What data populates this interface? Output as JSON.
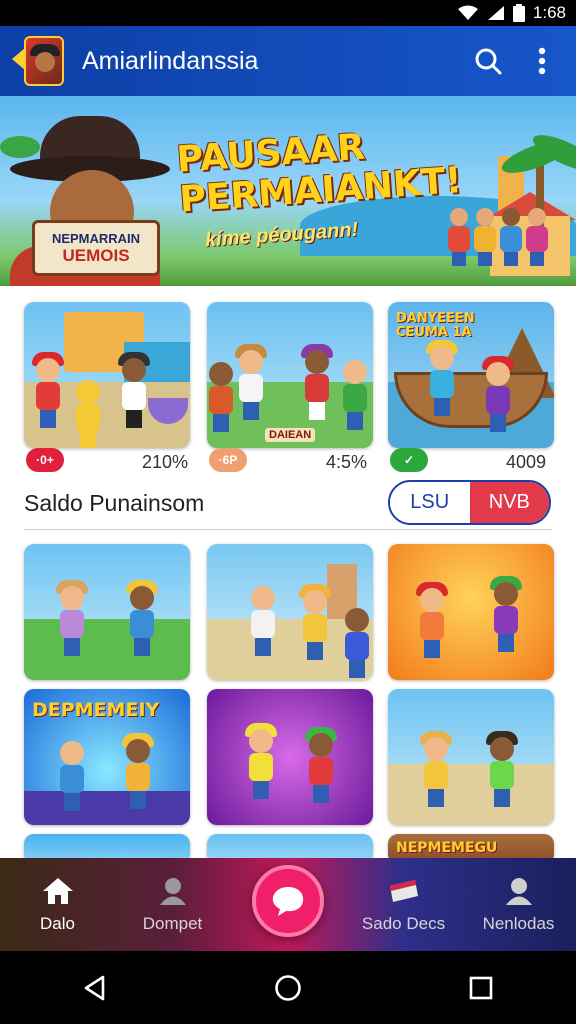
{
  "status_bar": {
    "time": "1:68"
  },
  "app_bar": {
    "title": "Amiarlindanssia"
  },
  "hero": {
    "headline_line1": "PAUSAAR",
    "headline_line2": "PERMAIANKT!",
    "subtitle": "kíme péougann!",
    "sign_line1": "NEPMARRAIN",
    "sign_line2": "UEMOIS"
  },
  "top_cards": [
    {
      "badge": "·0+",
      "badge_color": "#e0203c",
      "stat": "210%"
    },
    {
      "badge": "·6P",
      "badge_color": "#f0a070",
      "stat": "4:5%",
      "caption": "DAIEAN"
    },
    {
      "badge": "✓",
      "badge_color": "#2aa83a",
      "stat": "4009",
      "title": "DANYEEEN CEUMA 1A"
    }
  ],
  "section": {
    "title": "Saldo Punainsom",
    "segment_left": "LSU",
    "segment_right": "NVB"
  },
  "grid_cards": [
    {
      "title": ""
    },
    {
      "title": ""
    },
    {
      "title": ""
    },
    {
      "title": "DEPMEMEIY"
    },
    {
      "title": ""
    },
    {
      "title": ""
    },
    {
      "title": ""
    },
    {
      "title": ""
    },
    {
      "title": "NEPMEMEGU"
    }
  ],
  "bottom_nav": {
    "items": [
      {
        "label": "Dalo",
        "icon": "home-icon"
      },
      {
        "label": "Dompet",
        "icon": "person-icon"
      },
      {
        "label": "Sado Decs",
        "icon": "wallet-icon"
      },
      {
        "label": "Nenlodas",
        "icon": "account-icon"
      }
    ],
    "fab_icon": "chat-bubble-icon"
  },
  "colors": {
    "app_bar": "#1756c9",
    "accent": "#f01f6a",
    "segment_blue": "#1a3fa8",
    "segment_red": "#e23a4a"
  }
}
